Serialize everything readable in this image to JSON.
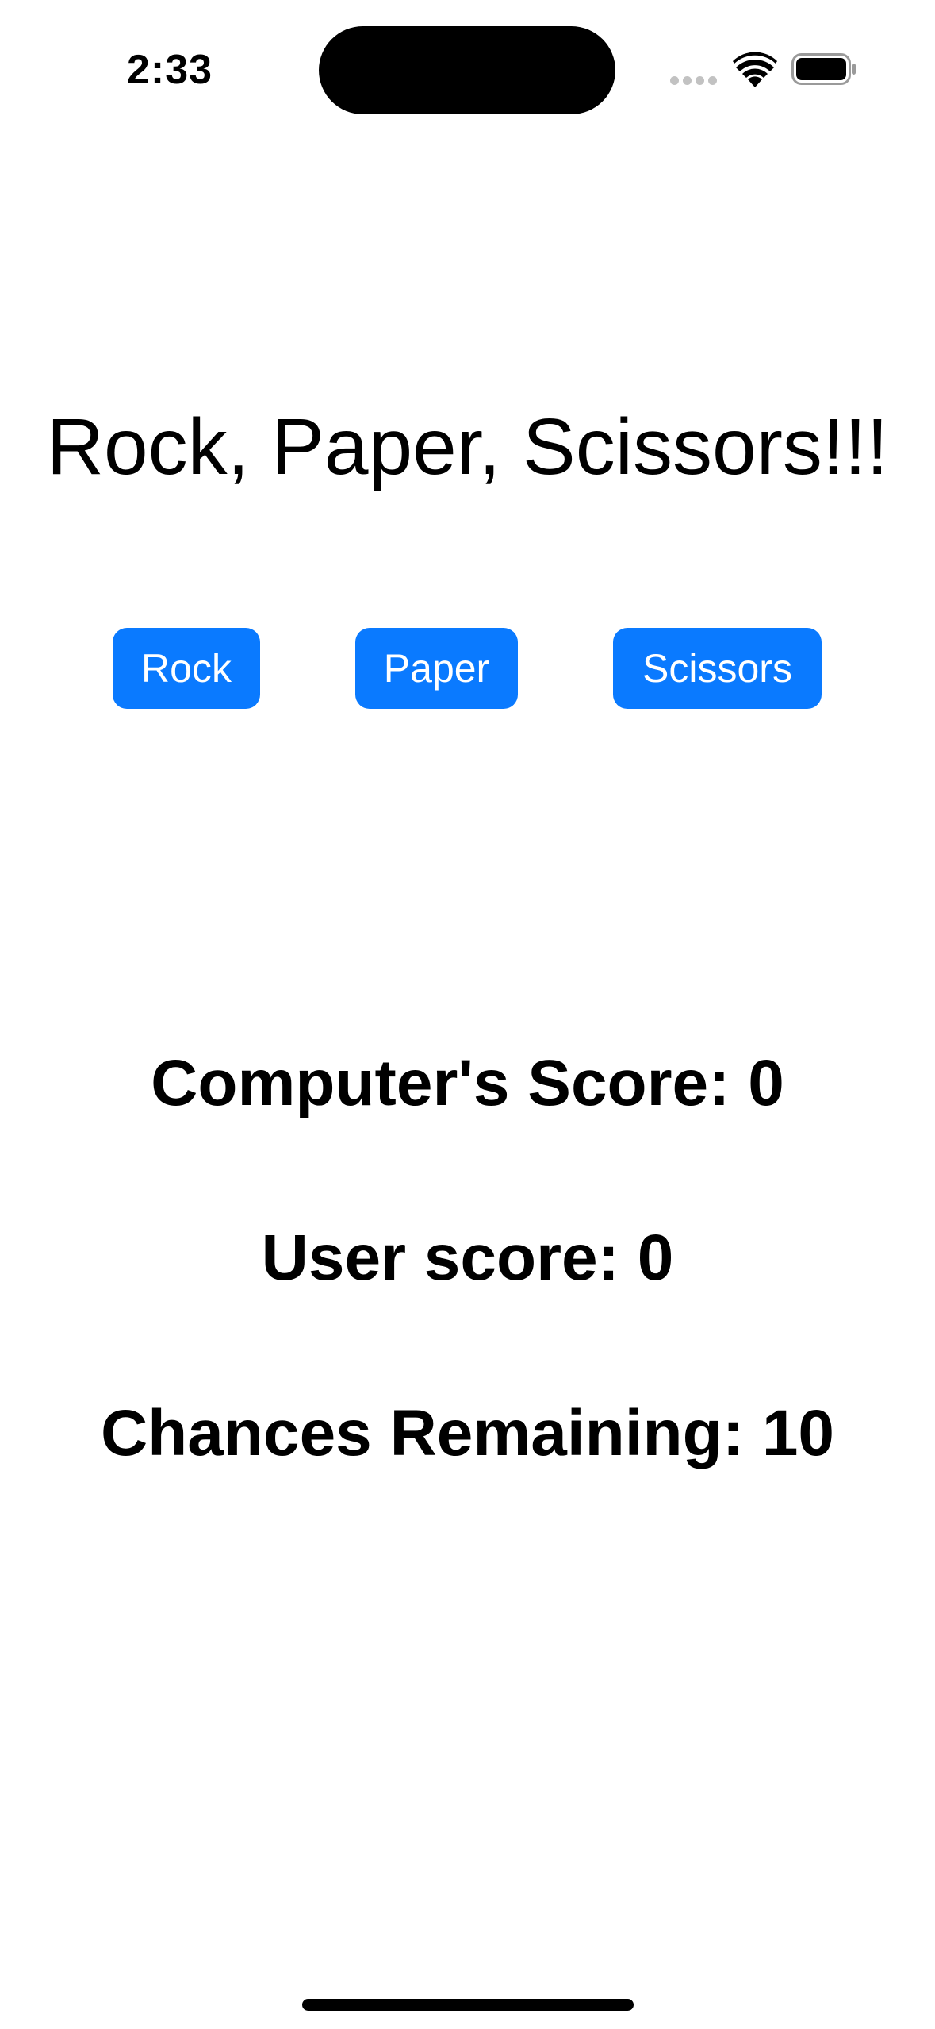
{
  "status_bar": {
    "time": "2:33",
    "icons": [
      "signal-icon",
      "wifi-icon",
      "battery-icon"
    ]
  },
  "game": {
    "title": "Rock, Paper, Scissors!!!",
    "buttons": {
      "rock": "Rock",
      "paper": "Paper",
      "scissors": "Scissors"
    },
    "stats": {
      "computer_score": "Computer's Score: 0",
      "user_score": "User score: 0",
      "chances_remaining": "Chances Remaining: 10"
    }
  },
  "colors": {
    "accent": "#0a7aff",
    "text": "#000000",
    "background": "#ffffff"
  }
}
